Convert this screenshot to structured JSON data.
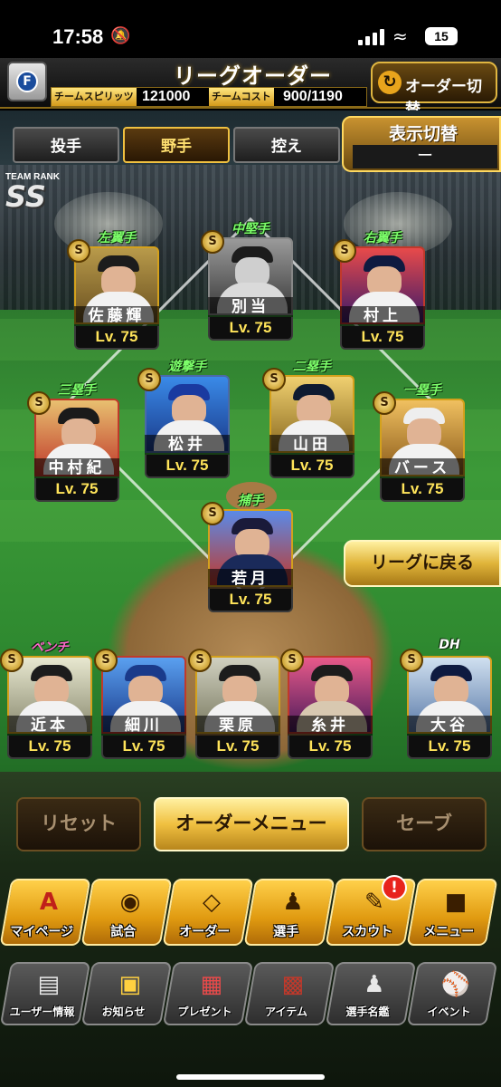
{
  "status_bar": {
    "time": "17:58",
    "battery": "15"
  },
  "header": {
    "title": "リーグオーダー",
    "team_spirit_label": "チームスピリッツ",
    "team_spirit_value": "121000",
    "team_cost_label": "チームコスト",
    "team_cost_value": "900/1190",
    "order_switch_label": "オーダー切替"
  },
  "tabs": [
    {
      "label": "投手",
      "active": false
    },
    {
      "label": "野手",
      "active": true
    },
    {
      "label": "控え",
      "active": false
    }
  ],
  "display_toggle": {
    "label": "表示切替",
    "value": "ー"
  },
  "team_rank": {
    "label": "TEAM RANK",
    "value": "SS"
  },
  "players": {
    "left_field": {
      "position": "左翼手",
      "name": "佐藤輝",
      "level": "Lv. 75"
    },
    "center_field": {
      "position": "中堅手",
      "name": "別当",
      "level": "Lv. 75"
    },
    "right_field": {
      "position": "右翼手",
      "name": "村上",
      "level": "Lv. 75"
    },
    "third_base": {
      "position": "三塁手",
      "name": "中村紀",
      "level": "Lv. 75"
    },
    "shortstop": {
      "position": "遊撃手",
      "name": "松井",
      "level": "Lv. 75"
    },
    "second_base": {
      "position": "二塁手",
      "name": "山田",
      "level": "Lv. 75"
    },
    "first_base": {
      "position": "一塁手",
      "name": "バース",
      "level": "Lv. 75"
    },
    "catcher": {
      "position": "捕手",
      "name": "若月",
      "level": "Lv. 75"
    },
    "dh": {
      "position": "DH",
      "name": "大谷",
      "level": "Lv. 75"
    }
  },
  "bench": {
    "label": "ベンチ",
    "players": [
      {
        "name": "近本",
        "level": "Lv. 75"
      },
      {
        "name": "細川",
        "level": "Lv. 75"
      },
      {
        "name": "栗原",
        "level": "Lv. 75"
      },
      {
        "name": "糸井",
        "level": "Lv. 75"
      }
    ]
  },
  "return_league_label": "リーグに戻る",
  "actions": {
    "reset": "リセット",
    "order_menu": "オーダーメニュー",
    "save": "セーブ"
  },
  "main_nav": [
    {
      "label": "マイページ",
      "icon": "a-emblem-icon"
    },
    {
      "label": "試合",
      "icon": "stadium-icon"
    },
    {
      "label": "オーダー",
      "icon": "diamond-icon"
    },
    {
      "label": "選手",
      "icon": "batter-icon"
    },
    {
      "label": "スカウト",
      "icon": "scout-icon"
    },
    {
      "label": "メニュー",
      "icon": "menu-mascot-icon"
    }
  ],
  "scout_badge": "!",
  "sub_nav": [
    {
      "label": "ユーザー情報",
      "icon": "id-card-icon"
    },
    {
      "label": "お知らせ",
      "icon": "notice-box-icon"
    },
    {
      "label": "プレゼント",
      "icon": "gift-icon"
    },
    {
      "label": "アイテム",
      "icon": "item-book-icon"
    },
    {
      "label": "選手名鑑",
      "icon": "player-directory-icon"
    },
    {
      "label": "イベント",
      "icon": "event-ball-icon"
    }
  ]
}
